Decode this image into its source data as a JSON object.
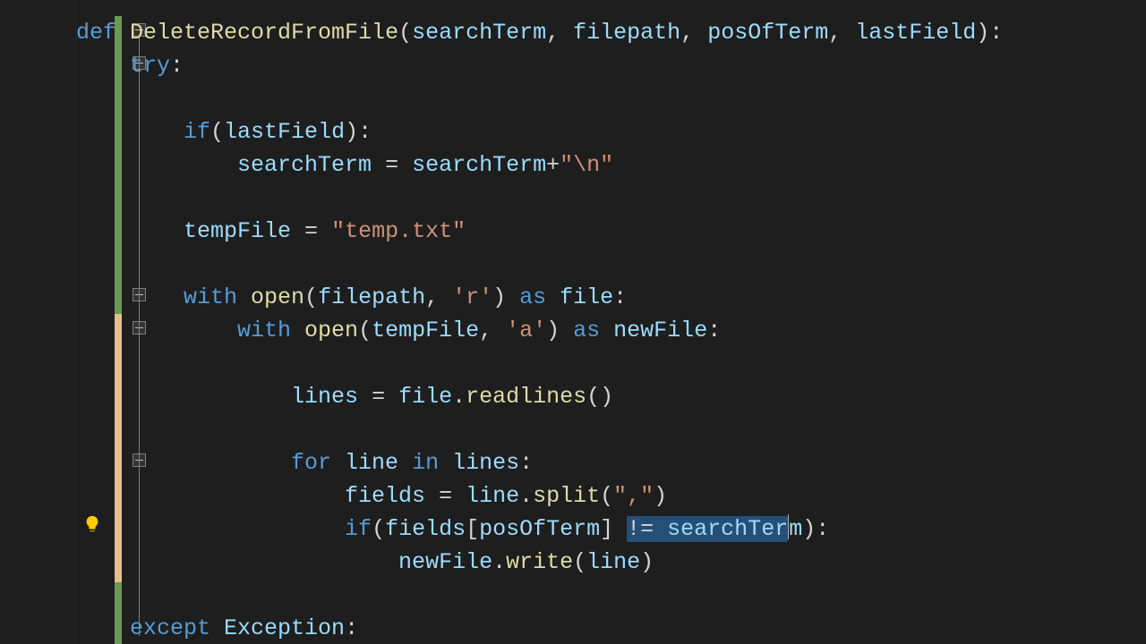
{
  "colors": {
    "background": "#1e1e1e",
    "keyword": "#569cd6",
    "flow": "#c586c0",
    "identifier": "#9cdcfe",
    "function": "#dcdcaa",
    "string": "#ce9178",
    "plain": "#d4d4d4",
    "selection": "#264f78",
    "mod_green": "#6a9955",
    "mod_yellow": "#e2c08d"
  },
  "code": {
    "l1_def": "def",
    "l1_fn": " DeleteRecordFromFile",
    "l1_paren_open": "(",
    "l1_p1": "searchTerm",
    "l1_c1": ", ",
    "l1_p2": "filepath",
    "l1_c2": ", ",
    "l1_p3": "posOfTerm",
    "l1_c3": ", ",
    "l1_p4": "lastField",
    "l1_close": "):",
    "l2_try": "    try",
    "l2_colon": ":",
    "l4_if": "        if",
    "l4_open": "(",
    "l4_var": "lastField",
    "l4_close": "):",
    "l5_lhs": "            searchTerm",
    "l5_eq": " = ",
    "l5_rhs1": "searchTerm",
    "l5_plus": "+",
    "l5_str": "\"\\n\"",
    "l7_lhs": "        tempFile",
    "l7_eq": " = ",
    "l7_str": "\"temp.txt\"",
    "l9_with": "        with",
    "l9_open": " open",
    "l9_paren": "(",
    "l9_arg1": "filepath",
    "l9_comma": ", ",
    "l9_mode": "'r'",
    "l9_cp": ") ",
    "l9_as": "as",
    "l9_alias": " file",
    "l9_colon": ":",
    "l10_with": "            with",
    "l10_open": " open",
    "l10_paren": "(",
    "l10_arg1": "tempFile",
    "l10_comma": ", ",
    "l10_mode": "'a'",
    "l10_cp": ") ",
    "l10_as": "as",
    "l10_alias": " newFile",
    "l10_colon": ":",
    "l12_lhs": "                lines",
    "l12_eq": " = ",
    "l12_obj": "file",
    "l12_dot": ".",
    "l12_mth": "readlines",
    "l12_call": "()",
    "l14_for": "                for",
    "l14_var": " line ",
    "l14_in": "in",
    "l14_iter": " lines",
    "l14_colon": ":",
    "l15_lhs": "                    fields",
    "l15_eq": " = ",
    "l15_obj": "line",
    "l15_dot": ".",
    "l15_mth": "split",
    "l15_op": "(",
    "l15_arg": "\",\"",
    "l15_cp": ")",
    "l16_if": "                    if",
    "l16_op": "(",
    "l16_f": "fields",
    "l16_br": "[",
    "l16_idx": "posOfTerm",
    "l16_brc": "] ",
    "l16_sel1": "!= ",
    "l16_sel2": "searchTer",
    "l16_after": "m",
    "l16_close": "):",
    "l17_obj": "                        newFile",
    "l17_dot": ".",
    "l17_mth": "write",
    "l17_op": "(",
    "l17_arg": "line",
    "l17_cp": ")",
    "l19_except": "    except",
    "l19_exc": " Exception",
    "l19_colon": ":"
  },
  "icons": {
    "bulb": "lightbulb-icon"
  }
}
